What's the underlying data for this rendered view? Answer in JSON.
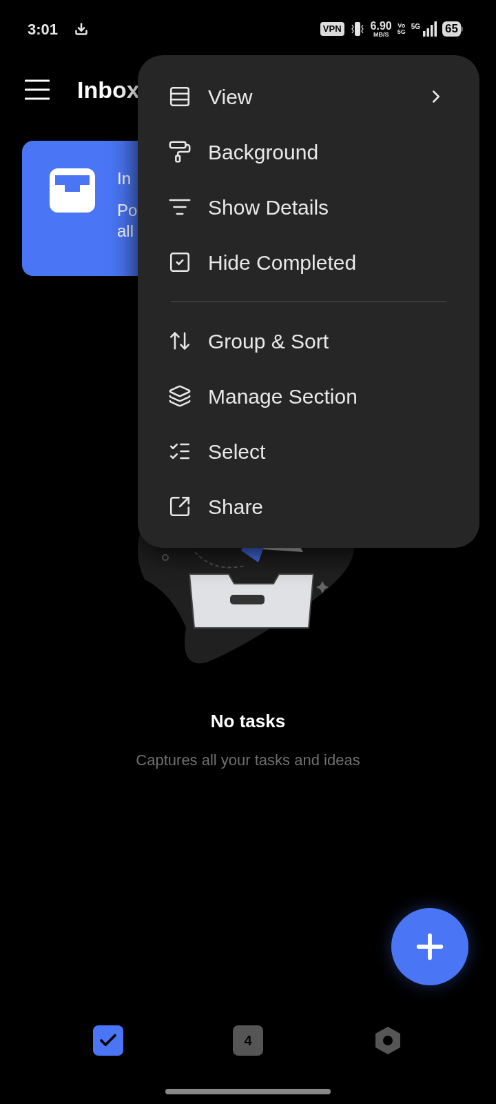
{
  "status_bar": {
    "time": "3:01",
    "vpn": "VPN",
    "speed": "6.90",
    "speed_unit": "MB/S",
    "volte_top": "Vo",
    "volte_bottom": "5G",
    "network": "5G",
    "battery": "65"
  },
  "header": {
    "title": "Inbox"
  },
  "card": {
    "title": "In",
    "line_1": "Po",
    "line_2": "all"
  },
  "menu": {
    "groups": [
      [
        {
          "label": "View",
          "has_submenu": true
        },
        {
          "label": "Background",
          "has_submenu": false
        },
        {
          "label": "Show Details",
          "has_submenu": false
        },
        {
          "label": "Hide Completed",
          "has_submenu": false
        }
      ],
      [
        {
          "label": "Group & Sort",
          "has_submenu": false
        },
        {
          "label": "Manage Section",
          "has_submenu": false
        },
        {
          "label": "Select",
          "has_submenu": false
        },
        {
          "label": "Share",
          "has_submenu": false
        }
      ]
    ]
  },
  "empty_state": {
    "title": "No tasks",
    "subtitle": "Captures all your tasks and ideas"
  },
  "bottom_nav": [
    {
      "kind": "tasks",
      "selected": true
    },
    {
      "kind": "calendar",
      "label": "4",
      "selected": false
    },
    {
      "kind": "settings",
      "selected": false
    }
  ]
}
